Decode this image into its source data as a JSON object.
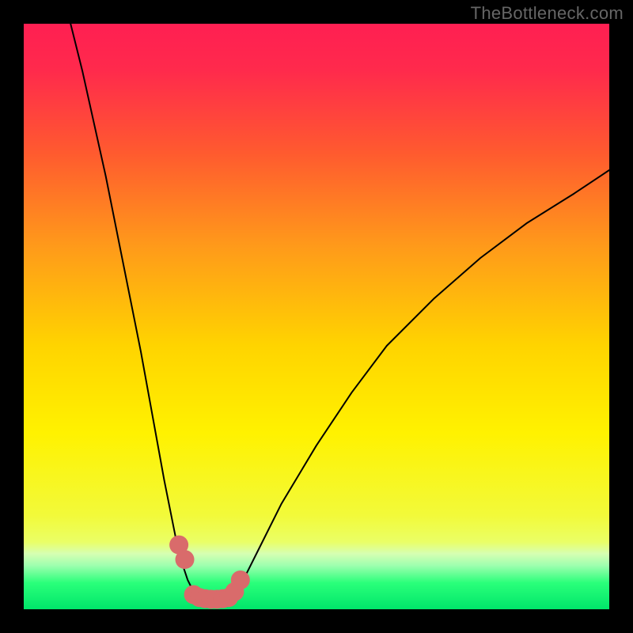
{
  "watermark": "TheBottleneck.com",
  "chart_data": {
    "type": "line",
    "title": "",
    "xlabel": "",
    "ylabel": "",
    "xlim": [
      0,
      100
    ],
    "ylim": [
      0,
      100
    ],
    "legend_position": "none",
    "grid": false,
    "background_gradient": {
      "direction": "vertical",
      "stops": [
        {
          "pos": 0.0,
          "color": "#ff1f52"
        },
        {
          "pos": 0.08,
          "color": "#ff2a4c"
        },
        {
          "pos": 0.22,
          "color": "#ff5a2f"
        },
        {
          "pos": 0.38,
          "color": "#ff9a1a"
        },
        {
          "pos": 0.55,
          "color": "#ffd400"
        },
        {
          "pos": 0.7,
          "color": "#fff200"
        },
        {
          "pos": 0.84,
          "color": "#f2fa3a"
        },
        {
          "pos": 0.885,
          "color": "#eaff66"
        },
        {
          "pos": 0.905,
          "color": "#d6ffb2"
        },
        {
          "pos": 0.925,
          "color": "#9fffaf"
        },
        {
          "pos": 0.955,
          "color": "#2aff7a"
        },
        {
          "pos": 1.0,
          "color": "#00e66a"
        }
      ]
    },
    "series": [
      {
        "name": "bottleneck-left",
        "stroke": "#000000",
        "stroke_width": 2,
        "x": [
          8,
          10,
          12,
          14,
          16,
          18,
          20,
          22,
          24,
          26,
          27,
          28,
          29,
          30,
          31
        ],
        "y": [
          100,
          92,
          83,
          74,
          64,
          54,
          44,
          33,
          22,
          12,
          8,
          5,
          3,
          2,
          1.5
        ]
      },
      {
        "name": "bottleneck-right",
        "stroke": "#000000",
        "stroke_width": 2,
        "x": [
          34,
          35,
          36,
          38,
          40,
          44,
          50,
          56,
          62,
          70,
          78,
          86,
          94,
          100
        ],
        "y": [
          1.5,
          2,
          3,
          6,
          10,
          18,
          28,
          37,
          45,
          53,
          60,
          66,
          71,
          75
        ]
      },
      {
        "name": "markers",
        "type": "scatter",
        "marker_color": "#d96b6b",
        "marker_radius": 12,
        "x": [
          26.5,
          27.5,
          29,
          30,
          31,
          32,
          33,
          34,
          35,
          36,
          37
        ],
        "y": [
          11,
          8.5,
          2.5,
          2,
          1.8,
          1.7,
          1.7,
          1.8,
          2,
          3,
          5
        ]
      }
    ]
  }
}
